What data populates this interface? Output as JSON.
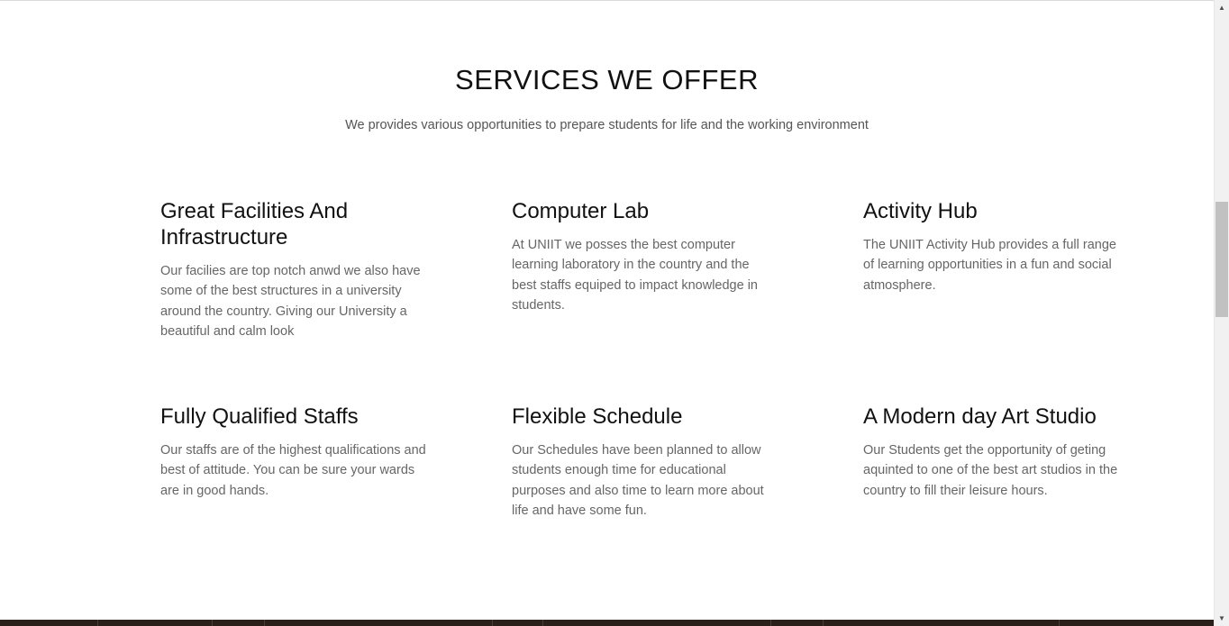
{
  "section": {
    "title": "SERVICES WE OFFER",
    "subtitle": "We provides various opportunities to prepare students for life and the working environment"
  },
  "services": [
    {
      "title": "Great Facilities And Infrastructure",
      "description": "Our facilies are top notch anwd we also have some of the best structures in a university around the country. Giving our University a beautiful and calm look"
    },
    {
      "title": "Computer Lab",
      "description": "At UNIIT we posses the best computer learning laboratory in the country and the best staffs equiped to impact knowledge in students."
    },
    {
      "title": "Activity Hub",
      "description": "The UNIIT Activity Hub provides a full range of learning opportunities in a fun and social atmosphere."
    },
    {
      "title": "Fully Qualified Staffs",
      "description": "Our staffs are of the highest qualifications and best of attitude. You can be sure your wards are in good hands."
    },
    {
      "title": "Flexible Schedule",
      "description": "Our Schedules have been planned to allow students enough time for educational purposes and also time to learn more about life and have some fun."
    },
    {
      "title": "A Modern day Art Studio",
      "description": "Our Students get the opportunity of geting aquinted to one of the best art studios in the country to fill their leisure hours."
    }
  ],
  "scrollbar": {
    "up_icon": "▲",
    "down_icon": "▼"
  },
  "colors": {
    "heading": "#111111",
    "body_text": "#666666",
    "footer": "#2a2019",
    "scroll_thumb": "#c1c1c1"
  }
}
